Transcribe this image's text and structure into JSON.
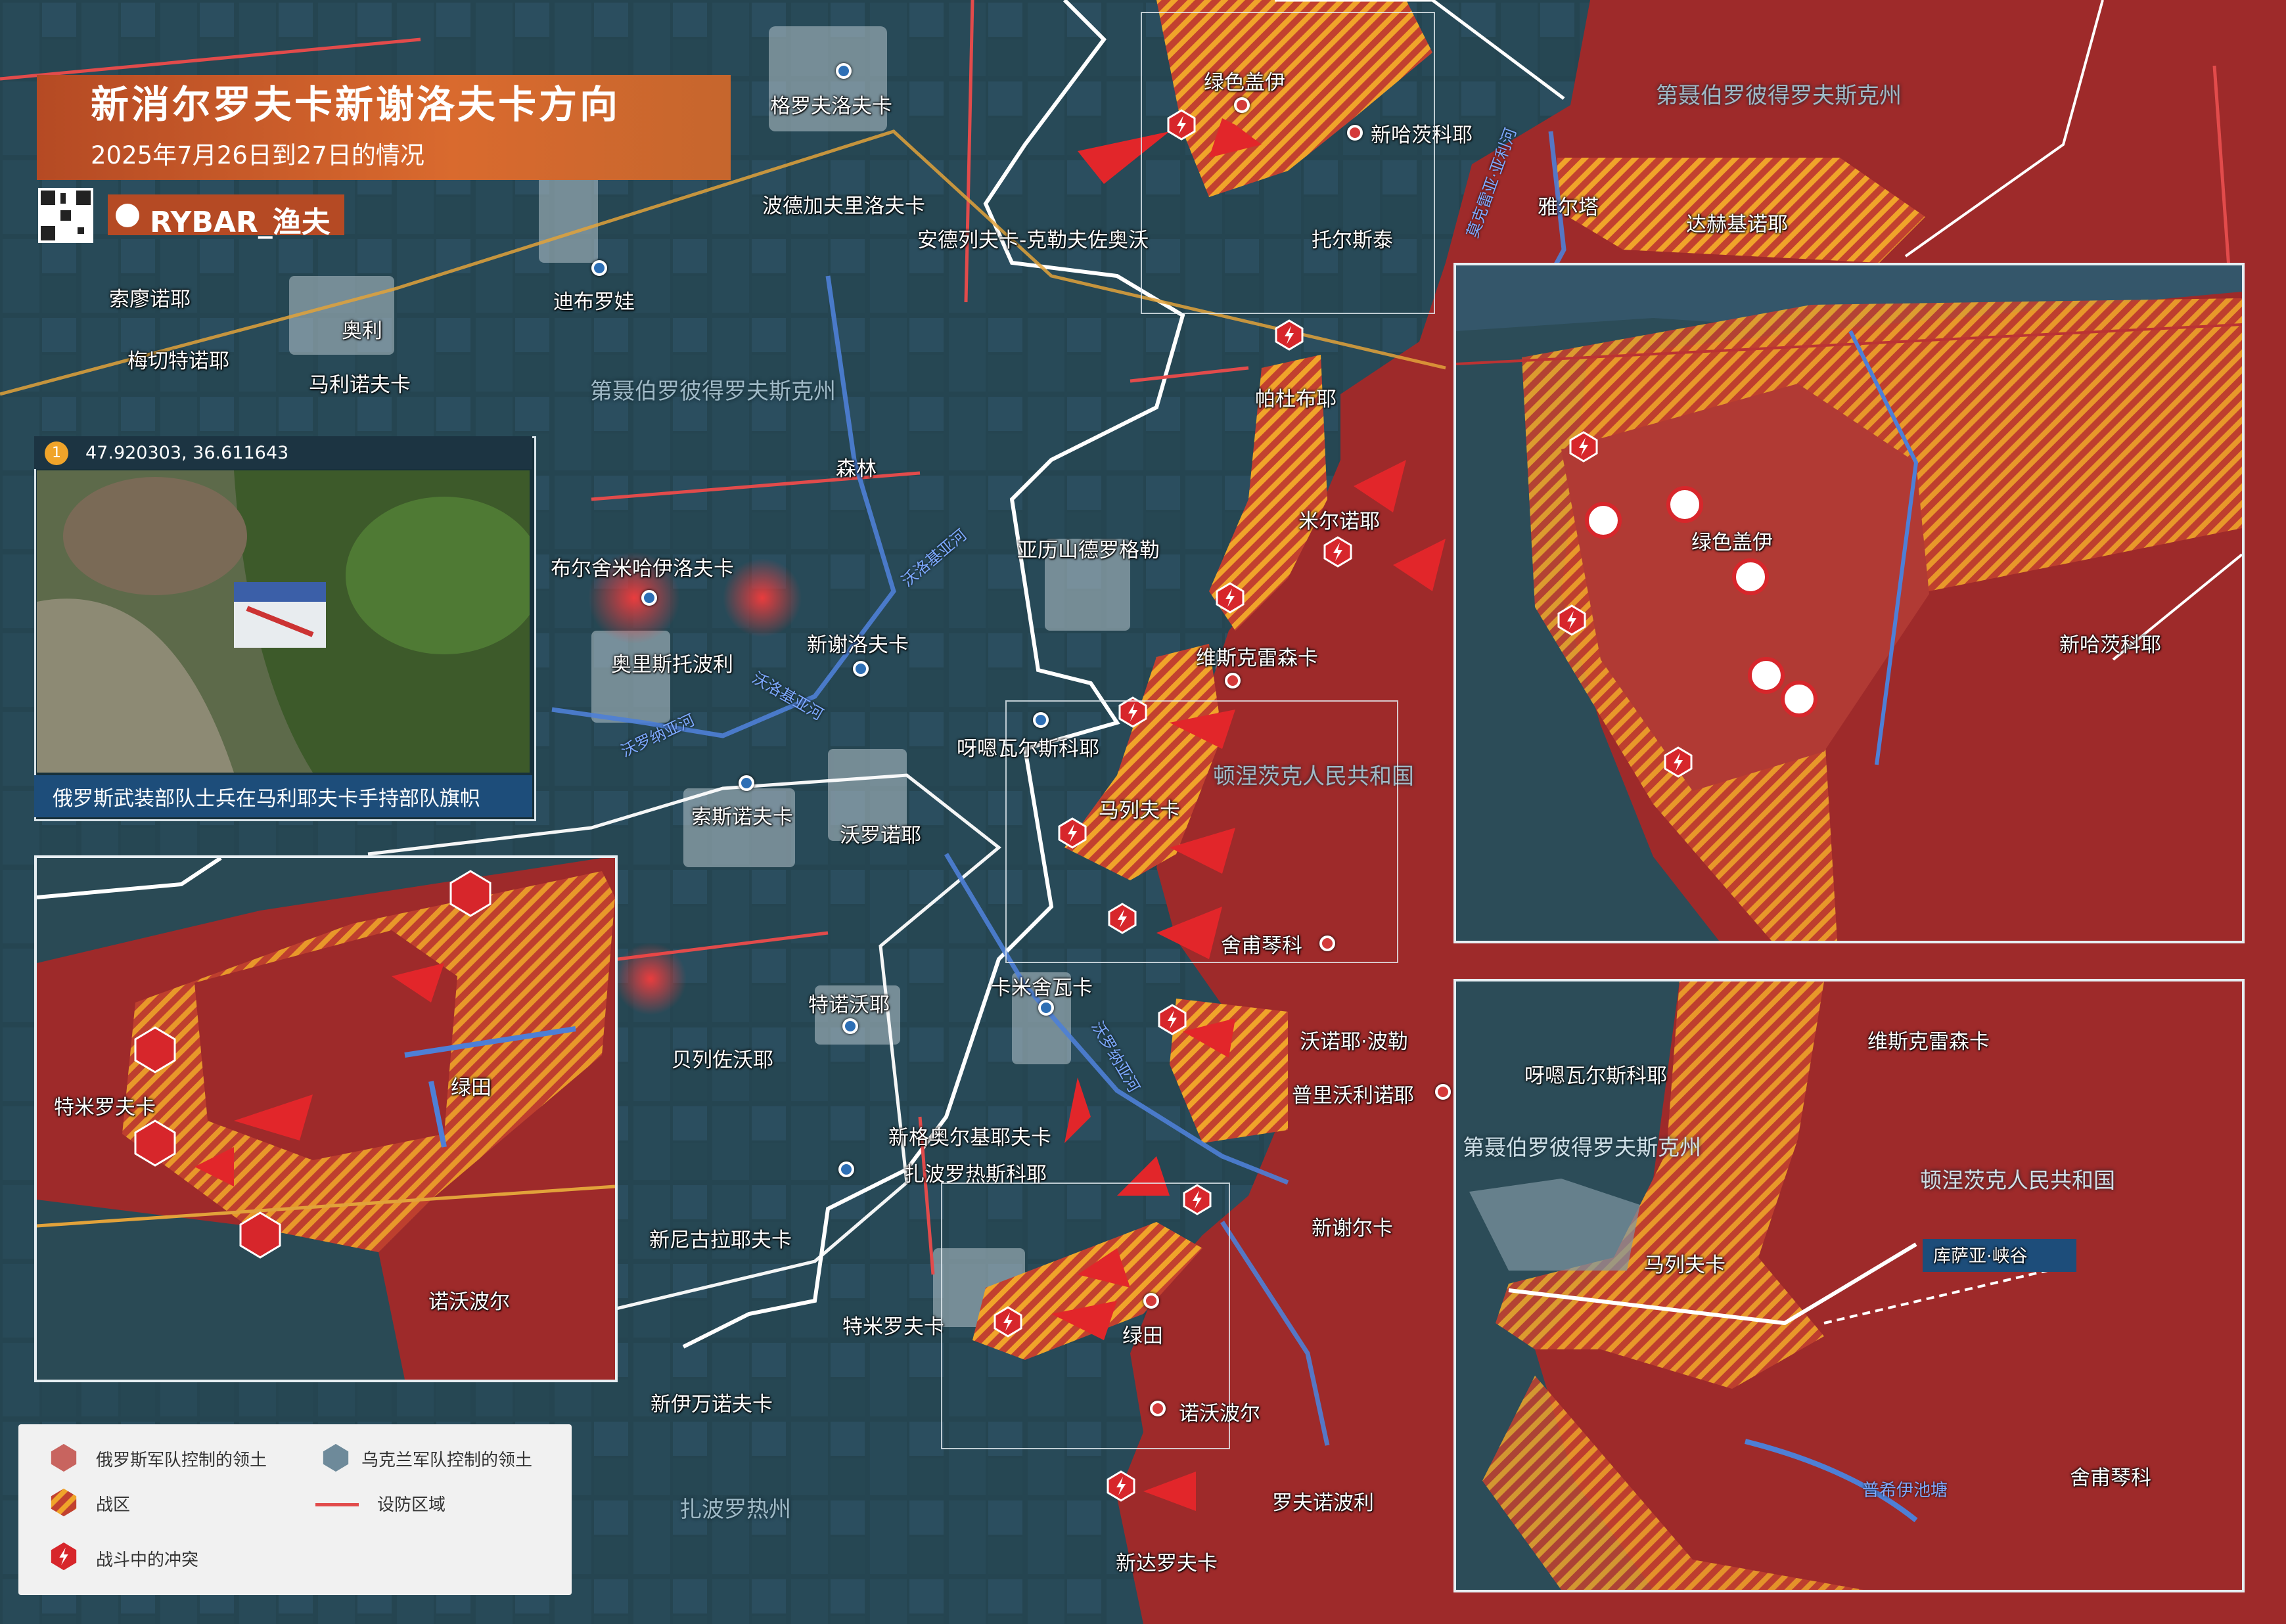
{
  "header": {
    "title": "新消尔罗夫卡新谢洛夫卡方向",
    "subtitle": "2025年7月26日到27日的情况",
    "brand": "RYBAR_渔夫"
  },
  "photo_inset": {
    "badge": "1",
    "coordinates": "47.920303, 36.611643",
    "caption": "俄罗斯武装部队士兵在马利耶夫卡手持部队旗帜"
  },
  "regions": {
    "dnipro_top": "第聂伯罗彼得罗夫斯克州",
    "dnipro_mid": "第聂伯罗彼得罗夫斯克州",
    "donetsk": "顿涅茨克人民共和国",
    "zaporizhzhia": "扎波罗热州"
  },
  "places": {
    "horikhove": "格罗夫洛夫卡",
    "zelenyi_hai": "绿色盖伊",
    "novokhatske": "新哈茨科耶",
    "podgaybarivka": "波德加夫里洛夫卡",
    "andriivka": "安德列夫卡-克勒夫佐奥沃",
    "tolstoi": "托尔斯泰",
    "sosnivka": "索廖诺耶",
    "oleksandrivka": "奥利",
    "dybrova": "迪布罗娃",
    "mechetne": "梅切特诺耶",
    "malynivka": "马利诺夫卡",
    "yalta": "雅尔塔",
    "dachne": "达赫基诺耶",
    "piddubne": "帕杜布耶",
    "lisne": "森林",
    "myrne": "米尔诺耶",
    "oleksandrohrad": "亚历山德罗格勒",
    "burshe": "布尔舍米哈伊洛夫卡",
    "ostapovo": "奥里斯托波利",
    "novoselivka": "新谢洛夫卡",
    "vyshneve": "维斯克雷森卡",
    "yanvarske": "呀嗯瓦尔斯科耶",
    "sosnivka2": "索斯诺夫卡",
    "voroshylove": "沃罗诺耶",
    "malyivka": "马列夫卡",
    "sheyneyko": "舍甫琴科",
    "kamyshuvakha": "卡米舍瓦卡",
    "trnovo": "特诺沃耶",
    "berezove": "贝列佐沃耶",
    "novoponomarivka": "沃诺耶·波勒",
    "prilisne": "普里沃利诺耶",
    "novohryhorivka": "新格奥尔基耶夫卡",
    "zaporizke": "扎波罗热斯科耶",
    "novomykolaivka": "新尼古拉耶夫卡",
    "novosilka": "新谢尔卡",
    "temyrivka": "特米罗夫卡",
    "zelene": "绿田",
    "novopole": "诺沃波尔",
    "novoivanivka": "新伊万诺夫卡",
    "rivnopil": "罗夫诺波利",
    "novodarivka": "新达罗夫卡",
    "kurasy": "库萨亚·峡谷",
    "pond": "普希伊池塘"
  },
  "rivers": {
    "r1": "沃洛基亚河",
    "r2": "沃洛基亚河",
    "r3": "沃罗纳亚河",
    "r4": "沃罗纳亚河",
    "r5": "莫克雷亚·亚利河"
  },
  "legend": {
    "ru_territory": "俄罗斯军队控制的领土",
    "ua_territory": "乌克兰军队控制的领土",
    "combat_zone": "战区",
    "defense_zone": "设防区域",
    "clash": "战斗中的冲突"
  },
  "colors": {
    "russian": "#9e2a2a",
    "russian_light": "#c8453f",
    "ukrainian": "#3f6f8c",
    "combat_stripes": "#f0a42a",
    "defense_line": "#e24b4b",
    "front_line": "#ffffff",
    "accent": "#d96a2e"
  }
}
